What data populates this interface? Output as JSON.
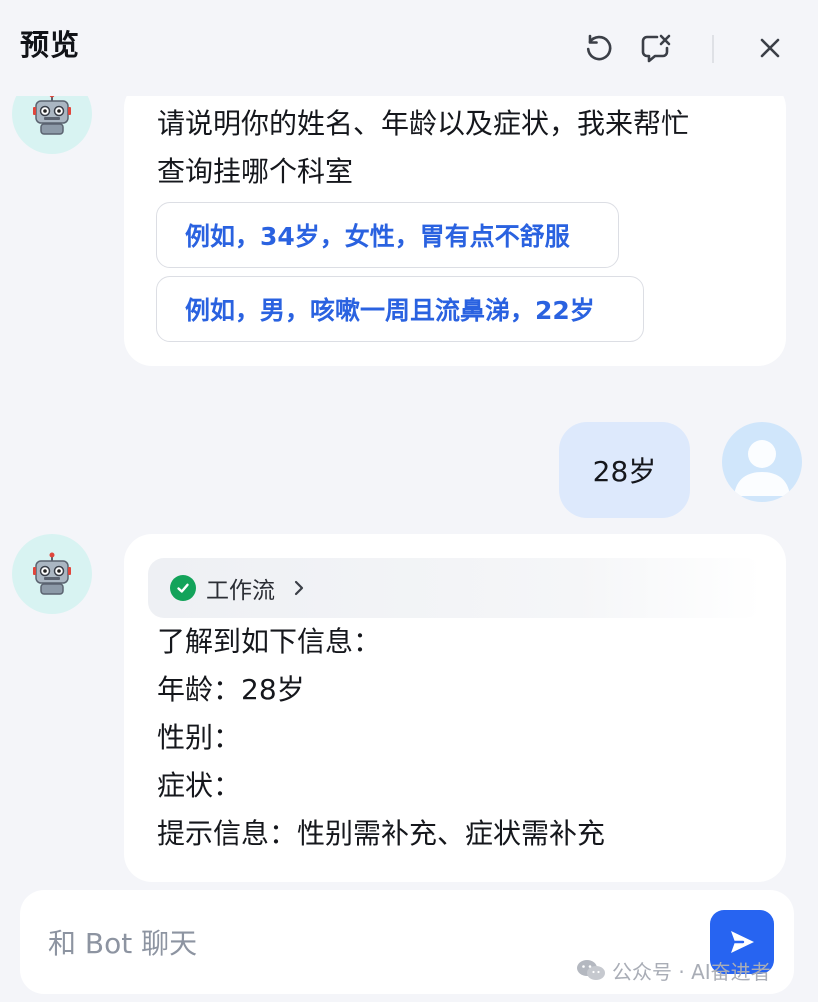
{
  "header": {
    "title": "预览",
    "refresh_icon": "refresh-icon",
    "clear_chat_icon": "clear-chat-icon",
    "close_icon": "close-icon"
  },
  "messages": {
    "bot_1": {
      "line_1": "请说明你的姓名、年龄以及症状，我来帮忙",
      "line_2": "查询挂哪个科室",
      "suggestions": [
        "例如，34岁，女性，胃有点不舒服",
        "例如，男，咳嗽一周且流鼻涕，22岁"
      ]
    },
    "user_1": {
      "text": "28岁"
    },
    "bot_2": {
      "workflow_label": "工作流",
      "lines": [
        "了解到如下信息：",
        "年龄：28岁",
        "性别：",
        "症状：",
        "提示信息：性别需补充、症状需补充"
      ]
    }
  },
  "input": {
    "placeholder": "和 Bot 聊天"
  },
  "watermark": {
    "text": "公众号 · AI奋进者"
  },
  "colors": {
    "accent": "#2764f1",
    "suggestion_text": "#2a62e0",
    "user_bubble": "#dde9fc",
    "success": "#13a35a",
    "background": "#f4f5f9"
  }
}
